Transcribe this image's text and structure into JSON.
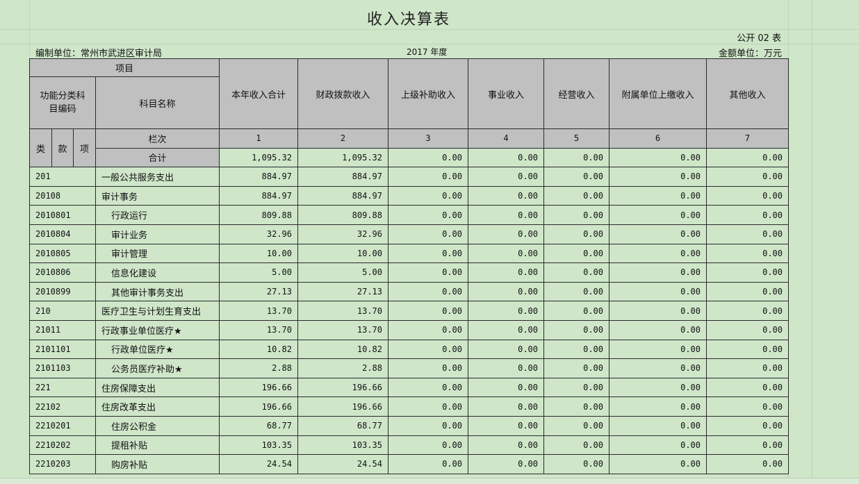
{
  "title": "收入决算表",
  "form_no": "公开 02 表",
  "unit_left": "编制单位：常州市武进区审计局",
  "year": "2017 年度",
  "unit_right": "金额单位：万元",
  "header": {
    "item": "项目",
    "func_code": "功能分类科\n目编码",
    "subject_name": "科目名称",
    "lei": "类",
    "kuan": "款",
    "xiang": "项",
    "lanci": "栏次",
    "heji": "合计",
    "columns": [
      "本年收入合计",
      "财政拨款收入",
      "上级补助收入",
      "事业收入",
      "经营收入",
      "附属单位上缴收入",
      "其他收入"
    ],
    "col_numbers": [
      "1",
      "2",
      "3",
      "4",
      "5",
      "6",
      "7"
    ]
  },
  "totals": [
    "1,095.32",
    "1,095.32",
    "0.00",
    "0.00",
    "0.00",
    "0.00",
    "0.00"
  ],
  "rows": [
    {
      "code": "201",
      "name": "一般公共服务支出",
      "level": 1,
      "values": [
        "884.97",
        "884.97",
        "0.00",
        "0.00",
        "0.00",
        "0.00",
        "0.00"
      ]
    },
    {
      "code": "20108",
      "name": "审计事务",
      "level": 2,
      "values": [
        "884.97",
        "884.97",
        "0.00",
        "0.00",
        "0.00",
        "0.00",
        "0.00"
      ]
    },
    {
      "code": "2010801",
      "name": "行政运行",
      "level": 3,
      "values": [
        "809.88",
        "809.88",
        "0.00",
        "0.00",
        "0.00",
        "0.00",
        "0.00"
      ]
    },
    {
      "code": "2010804",
      "name": "审计业务",
      "level": 3,
      "values": [
        "32.96",
        "32.96",
        "0.00",
        "0.00",
        "0.00",
        "0.00",
        "0.00"
      ]
    },
    {
      "code": "2010805",
      "name": "审计管理",
      "level": 3,
      "values": [
        "10.00",
        "10.00",
        "0.00",
        "0.00",
        "0.00",
        "0.00",
        "0.00"
      ]
    },
    {
      "code": "2010806",
      "name": "信息化建设",
      "level": 3,
      "values": [
        "5.00",
        "5.00",
        "0.00",
        "0.00",
        "0.00",
        "0.00",
        "0.00"
      ]
    },
    {
      "code": "2010899",
      "name": "其他审计事务支出",
      "level": 3,
      "values": [
        "27.13",
        "27.13",
        "0.00",
        "0.00",
        "0.00",
        "0.00",
        "0.00"
      ]
    },
    {
      "code": "210",
      "name": "医疗卫生与计划生育支出",
      "level": 1,
      "values": [
        "13.70",
        "13.70",
        "0.00",
        "0.00",
        "0.00",
        "0.00",
        "0.00"
      ]
    },
    {
      "code": "21011",
      "name": "行政事业单位医疗★",
      "level": 2,
      "values": [
        "13.70",
        "13.70",
        "0.00",
        "0.00",
        "0.00",
        "0.00",
        "0.00"
      ]
    },
    {
      "code": "2101101",
      "name": "行政单位医疗★",
      "level": 3,
      "values": [
        "10.82",
        "10.82",
        "0.00",
        "0.00",
        "0.00",
        "0.00",
        "0.00"
      ]
    },
    {
      "code": "2101103",
      "name": "公务员医疗补助★",
      "level": 3,
      "values": [
        "2.88",
        "2.88",
        "0.00",
        "0.00",
        "0.00",
        "0.00",
        "0.00"
      ]
    },
    {
      "code": "221",
      "name": "住房保障支出",
      "level": 1,
      "values": [
        "196.66",
        "196.66",
        "0.00",
        "0.00",
        "0.00",
        "0.00",
        "0.00"
      ]
    },
    {
      "code": "22102",
      "name": "住房改革支出",
      "level": 2,
      "values": [
        "196.66",
        "196.66",
        "0.00",
        "0.00",
        "0.00",
        "0.00",
        "0.00"
      ]
    },
    {
      "code": "2210201",
      "name": "住房公积金",
      "level": 3,
      "values": [
        "68.77",
        "68.77",
        "0.00",
        "0.00",
        "0.00",
        "0.00",
        "0.00"
      ]
    },
    {
      "code": "2210202",
      "name": "提租补贴",
      "level": 3,
      "values": [
        "103.35",
        "103.35",
        "0.00",
        "0.00",
        "0.00",
        "0.00",
        "0.00"
      ]
    },
    {
      "code": "2210203",
      "name": "购房补贴",
      "level": 3,
      "values": [
        "24.54",
        "24.54",
        "0.00",
        "0.00",
        "0.00",
        "0.00",
        "0.00"
      ]
    }
  ]
}
